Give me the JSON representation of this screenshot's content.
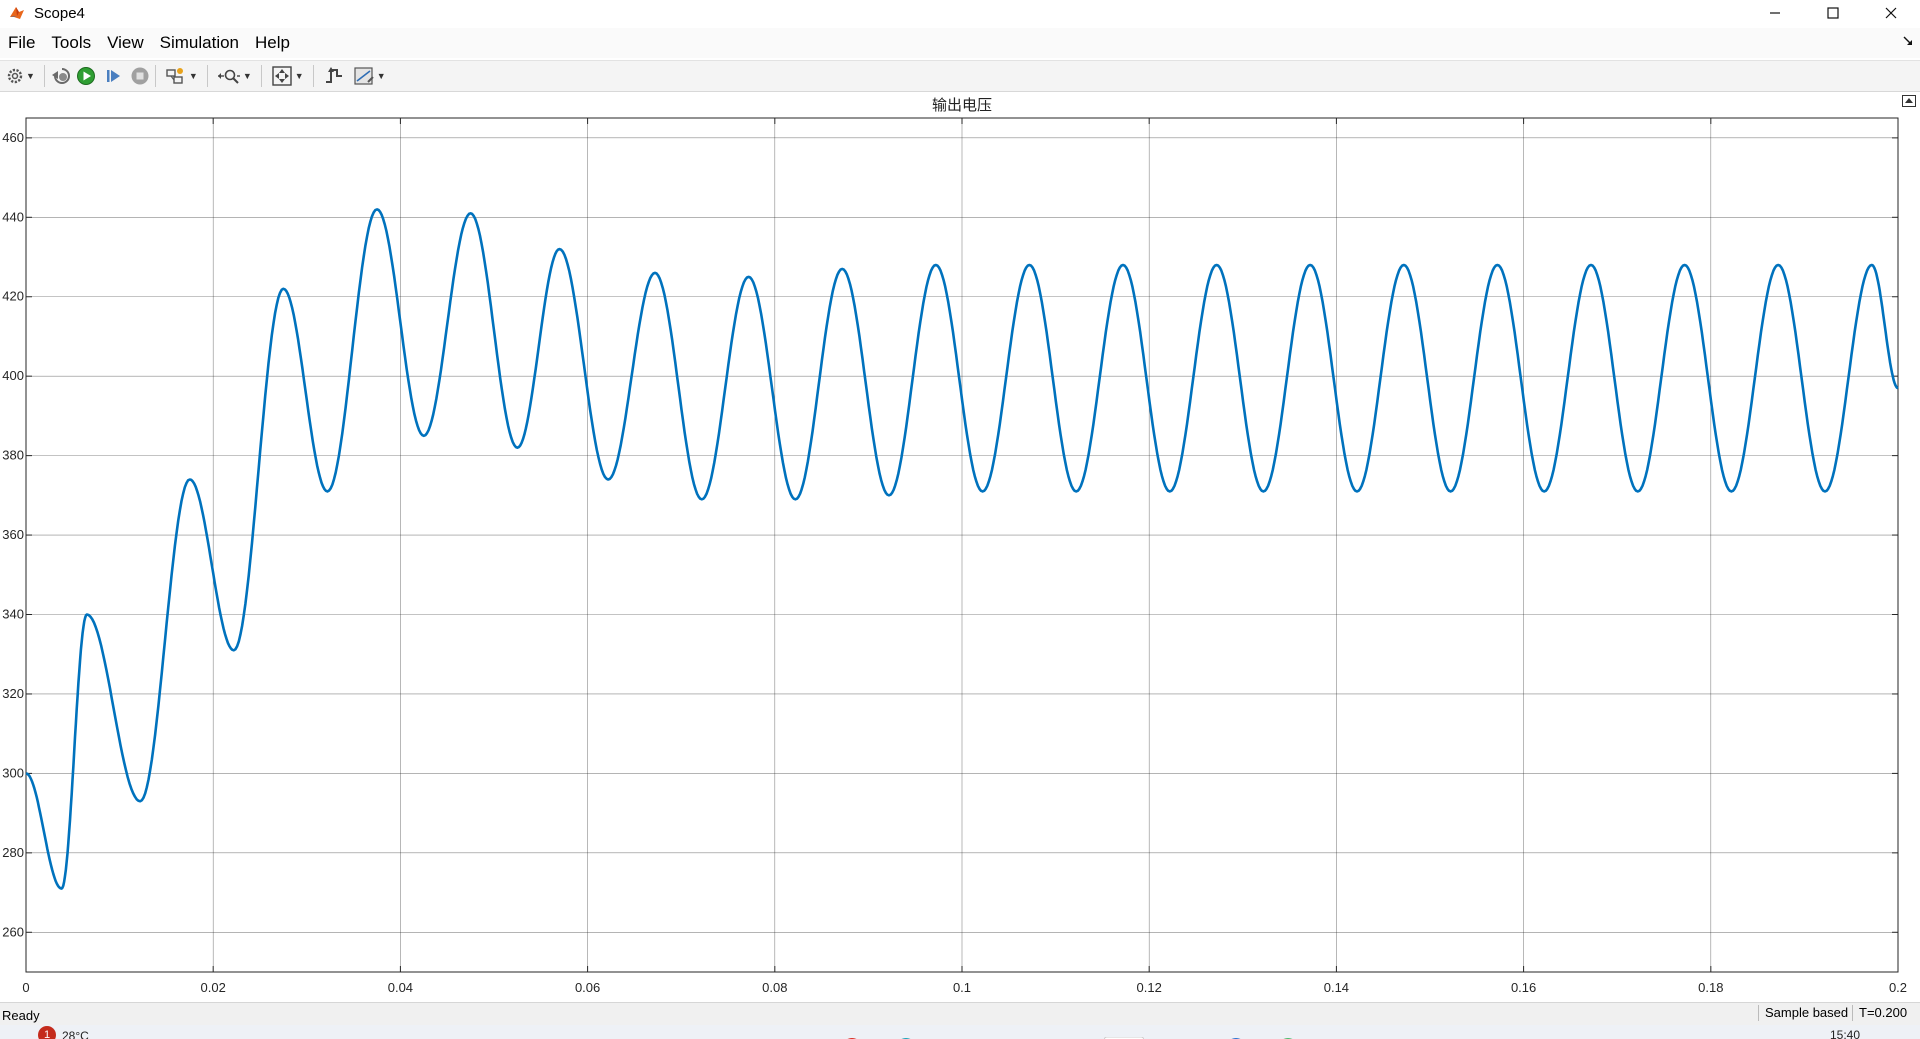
{
  "window": {
    "title": "Scope4",
    "app_icon": "matlab-icon",
    "controls": [
      "minimize-icon",
      "maximize-icon",
      "close-icon"
    ]
  },
  "menu": {
    "items": [
      "File",
      "Tools",
      "View",
      "Simulation",
      "Help"
    ],
    "undock_icon": "undock-arrow-icon"
  },
  "toolbar": {
    "buttons": [
      "configuration-properties-icon",
      "step-back-icon",
      "run-icon",
      "step-forward-icon",
      "stop-icon",
      "highlight-simulink-block-icon",
      "zoom-icon",
      "scale-axes-icon",
      "triggers-icon",
      "measurements-icon"
    ]
  },
  "chart_data": {
    "type": "line",
    "title": "输出电压",
    "xlabel": "",
    "ylabel": "",
    "xlim": [
      0,
      0.2
    ],
    "ylim": [
      250,
      465
    ],
    "x_ticks": [
      "0",
      "0.02",
      "0.04",
      "0.06",
      "0.08",
      "0.1",
      "0.12",
      "0.14",
      "0.16",
      "0.18",
      "0.2"
    ],
    "y_ticks": [
      "260",
      "280",
      "300",
      "320",
      "340",
      "360",
      "380",
      "400",
      "420",
      "440",
      "460"
    ],
    "grid": true,
    "legend": "none",
    "line_color": "#0072BD",
    "series": [
      {
        "x": [
          0,
          0.0038,
          0.0065,
          0.0122,
          0.0175,
          0.0222,
          0.0275,
          0.0322,
          0.0375,
          0.0425,
          0.0475,
          0.0525,
          0.057,
          0.0622,
          0.0672,
          0.0722,
          0.0772,
          0.0822,
          0.0872,
          0.0922,
          0.0972,
          0.1022,
          0.1072,
          0.1122,
          0.1172,
          0.1222,
          0.1272,
          0.1322,
          0.1372,
          0.1422,
          0.1472,
          0.1522,
          0.1572,
          0.1622,
          0.1672,
          0.1722,
          0.1772,
          0.1822,
          0.1872,
          0.1922,
          0.1972,
          0.2
        ],
        "y": [
          300,
          271,
          340,
          293,
          374,
          331,
          422,
          371,
          442,
          385,
          441,
          382,
          432,
          374,
          426,
          369,
          425,
          369,
          427,
          370,
          428,
          371,
          428,
          371,
          428,
          371,
          428,
          371,
          428,
          371,
          428,
          371,
          428,
          371,
          428,
          371,
          428,
          371,
          428,
          371,
          428,
          397
        ]
      }
    ]
  },
  "status": {
    "left": "Ready",
    "mode": "Sample based",
    "time": "T=0.200"
  },
  "taskbar": {
    "weather_badge": "1",
    "weather": "28°C",
    "clock": "15:40"
  }
}
